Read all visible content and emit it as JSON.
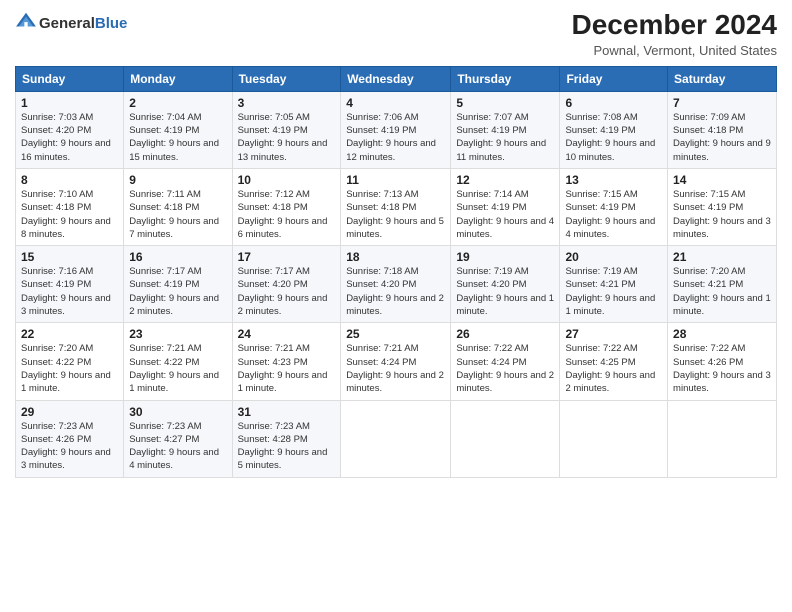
{
  "header": {
    "logo_general": "General",
    "logo_blue": "Blue",
    "title": "December 2024",
    "subtitle": "Pownal, Vermont, United States"
  },
  "calendar": {
    "days_of_week": [
      "Sunday",
      "Monday",
      "Tuesday",
      "Wednesday",
      "Thursday",
      "Friday",
      "Saturday"
    ],
    "weeks": [
      [
        {
          "day": "1",
          "sunrise": "7:03 AM",
          "sunset": "4:20 PM",
          "daylight": "9 hours and 16 minutes."
        },
        {
          "day": "2",
          "sunrise": "7:04 AM",
          "sunset": "4:19 PM",
          "daylight": "9 hours and 15 minutes."
        },
        {
          "day": "3",
          "sunrise": "7:05 AM",
          "sunset": "4:19 PM",
          "daylight": "9 hours and 13 minutes."
        },
        {
          "day": "4",
          "sunrise": "7:06 AM",
          "sunset": "4:19 PM",
          "daylight": "9 hours and 12 minutes."
        },
        {
          "day": "5",
          "sunrise": "7:07 AM",
          "sunset": "4:19 PM",
          "daylight": "9 hours and 11 minutes."
        },
        {
          "day": "6",
          "sunrise": "7:08 AM",
          "sunset": "4:19 PM",
          "daylight": "9 hours and 10 minutes."
        },
        {
          "day": "7",
          "sunrise": "7:09 AM",
          "sunset": "4:18 PM",
          "daylight": "9 hours and 9 minutes."
        }
      ],
      [
        {
          "day": "8",
          "sunrise": "7:10 AM",
          "sunset": "4:18 PM",
          "daylight": "9 hours and 8 minutes."
        },
        {
          "day": "9",
          "sunrise": "7:11 AM",
          "sunset": "4:18 PM",
          "daylight": "9 hours and 7 minutes."
        },
        {
          "day": "10",
          "sunrise": "7:12 AM",
          "sunset": "4:18 PM",
          "daylight": "9 hours and 6 minutes."
        },
        {
          "day": "11",
          "sunrise": "7:13 AM",
          "sunset": "4:18 PM",
          "daylight": "9 hours and 5 minutes."
        },
        {
          "day": "12",
          "sunrise": "7:14 AM",
          "sunset": "4:19 PM",
          "daylight": "9 hours and 4 minutes."
        },
        {
          "day": "13",
          "sunrise": "7:15 AM",
          "sunset": "4:19 PM",
          "daylight": "9 hours and 4 minutes."
        },
        {
          "day": "14",
          "sunrise": "7:15 AM",
          "sunset": "4:19 PM",
          "daylight": "9 hours and 3 minutes."
        }
      ],
      [
        {
          "day": "15",
          "sunrise": "7:16 AM",
          "sunset": "4:19 PM",
          "daylight": "9 hours and 3 minutes."
        },
        {
          "day": "16",
          "sunrise": "7:17 AM",
          "sunset": "4:19 PM",
          "daylight": "9 hours and 2 minutes."
        },
        {
          "day": "17",
          "sunrise": "7:17 AM",
          "sunset": "4:20 PM",
          "daylight": "9 hours and 2 minutes."
        },
        {
          "day": "18",
          "sunrise": "7:18 AM",
          "sunset": "4:20 PM",
          "daylight": "9 hours and 2 minutes."
        },
        {
          "day": "19",
          "sunrise": "7:19 AM",
          "sunset": "4:20 PM",
          "daylight": "9 hours and 1 minute."
        },
        {
          "day": "20",
          "sunrise": "7:19 AM",
          "sunset": "4:21 PM",
          "daylight": "9 hours and 1 minute."
        },
        {
          "day": "21",
          "sunrise": "7:20 AM",
          "sunset": "4:21 PM",
          "daylight": "9 hours and 1 minute."
        }
      ],
      [
        {
          "day": "22",
          "sunrise": "7:20 AM",
          "sunset": "4:22 PM",
          "daylight": "9 hours and 1 minute."
        },
        {
          "day": "23",
          "sunrise": "7:21 AM",
          "sunset": "4:22 PM",
          "daylight": "9 hours and 1 minute."
        },
        {
          "day": "24",
          "sunrise": "7:21 AM",
          "sunset": "4:23 PM",
          "daylight": "9 hours and 1 minute."
        },
        {
          "day": "25",
          "sunrise": "7:21 AM",
          "sunset": "4:24 PM",
          "daylight": "9 hours and 2 minutes."
        },
        {
          "day": "26",
          "sunrise": "7:22 AM",
          "sunset": "4:24 PM",
          "daylight": "9 hours and 2 minutes."
        },
        {
          "day": "27",
          "sunrise": "7:22 AM",
          "sunset": "4:25 PM",
          "daylight": "9 hours and 2 minutes."
        },
        {
          "day": "28",
          "sunrise": "7:22 AM",
          "sunset": "4:26 PM",
          "daylight": "9 hours and 3 minutes."
        }
      ],
      [
        {
          "day": "29",
          "sunrise": "7:23 AM",
          "sunset": "4:26 PM",
          "daylight": "9 hours and 3 minutes."
        },
        {
          "day": "30",
          "sunrise": "7:23 AM",
          "sunset": "4:27 PM",
          "daylight": "9 hours and 4 minutes."
        },
        {
          "day": "31",
          "sunrise": "7:23 AM",
          "sunset": "4:28 PM",
          "daylight": "9 hours and 5 minutes."
        },
        null,
        null,
        null,
        null
      ]
    ]
  }
}
